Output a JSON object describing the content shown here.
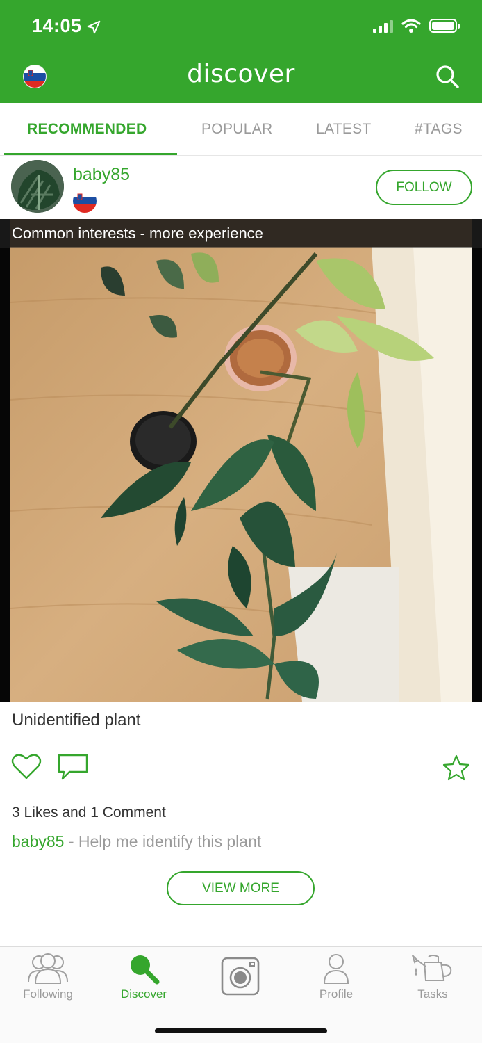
{
  "status_bar": {
    "time": "14:05"
  },
  "header": {
    "title": "discover"
  },
  "tabs": [
    {
      "label": "RECOMMENDED",
      "active": true
    },
    {
      "label": "POPULAR",
      "active": false
    },
    {
      "label": "LATEST",
      "active": false
    },
    {
      "label": "#TAGS",
      "active": false
    }
  ],
  "post": {
    "username": "baby85",
    "follow_label": "FOLLOW",
    "photo_caption": "Common interests - more experience",
    "title": "Unidentified plant",
    "stats": "3 Likes and 1 Comment",
    "comment": {
      "user": "baby85",
      "text": " - Help me identify this plant"
    },
    "view_more_label": "VIEW MORE"
  },
  "bottom_nav": [
    {
      "label": "Following",
      "icon": "people-icon",
      "active": false
    },
    {
      "label": "Discover",
      "icon": "search-icon",
      "active": true
    },
    {
      "label": "",
      "icon": "camera-icon",
      "active": false
    },
    {
      "label": "Profile",
      "icon": "person-icon",
      "active": false
    },
    {
      "label": "Tasks",
      "icon": "watering-can-icon",
      "active": false
    }
  ],
  "colors": {
    "brand": "#35a62d",
    "muted": "#9a9a9a",
    "text": "#333333"
  }
}
